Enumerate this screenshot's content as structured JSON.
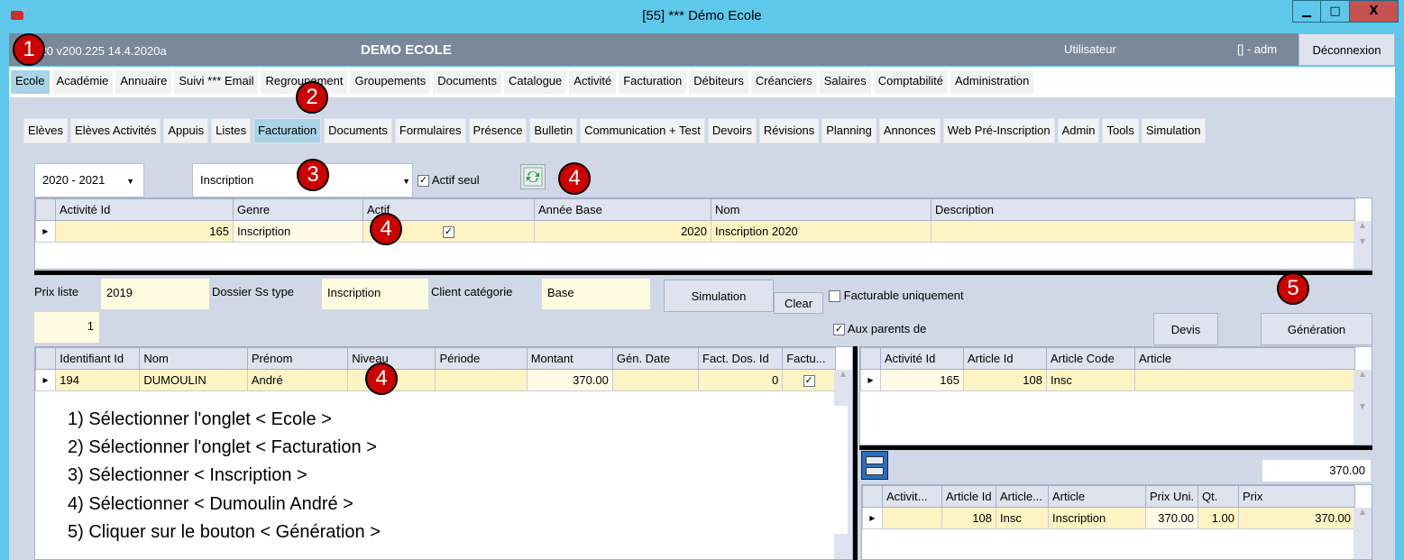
{
  "window": {
    "title": "[55] *** Démo Ecole",
    "controls": {
      "minimize": "▁",
      "maximize": "□",
      "close": "X"
    }
  },
  "header": {
    "version": "2020 v200.225 14.4.2020a",
    "org_name": "DEMO ECOLE",
    "user_label": "Utilisateur",
    "user_value": "[] - adm",
    "logout_label": "Déconnexion"
  },
  "main_menu": [
    {
      "label": "Ecole",
      "active": true
    },
    {
      "label": "Académie"
    },
    {
      "label": "Annuaire"
    },
    {
      "label": "Suivi *** Email"
    },
    {
      "label": "Regroupement"
    },
    {
      "label": "Groupements"
    },
    {
      "label": "Documents"
    },
    {
      "label": "Catalogue"
    },
    {
      "label": "Activité"
    },
    {
      "label": "Facturation"
    },
    {
      "label": "Débiteurs"
    },
    {
      "label": "Créanciers"
    },
    {
      "label": "Salaires"
    },
    {
      "label": "Comptabilité"
    },
    {
      "label": "Administration"
    }
  ],
  "sub_tabs": [
    {
      "label": "Elèves"
    },
    {
      "label": "Elèves Activités"
    },
    {
      "label": "Appuis"
    },
    {
      "label": "Listes"
    },
    {
      "label": "Facturation",
      "active": true
    },
    {
      "label": "Documents"
    },
    {
      "label": "Formulaires"
    },
    {
      "label": "Présence"
    },
    {
      "label": "Bulletin"
    },
    {
      "label": "Communication + Test"
    },
    {
      "label": "Devoirs"
    },
    {
      "label": "Révisions"
    },
    {
      "label": "Planning"
    },
    {
      "label": "Annonces"
    },
    {
      "label": "Web Pré-Inscription"
    },
    {
      "label": "Admin"
    },
    {
      "label": "Tools"
    },
    {
      "label": "Simulation"
    }
  ],
  "filters": {
    "year": "2020 - 2021",
    "genre": "Inscription",
    "active_only_label": "Actif seul",
    "active_only_checked": true,
    "refresh_icon": "refresh-icon"
  },
  "activity_grid": {
    "columns": [
      "Activité Id",
      "Genre",
      "Actif",
      "Année Base",
      "Nom",
      "Description"
    ],
    "rows": [
      {
        "activite_id": "165",
        "genre": "Inscription",
        "actif": true,
        "annee_base": "2020",
        "nom": "Inscription 2020",
        "description": ""
      }
    ]
  },
  "info_fields": {
    "prix_liste_label": "Prix liste",
    "prix_liste_value": "2019",
    "dossier_label": "Dossier Ss type",
    "dossier_value": "Inscription",
    "client_label": "Client catégorie",
    "client_value": "Base",
    "count_value": "1"
  },
  "actions": {
    "simulation": "Simulation",
    "clear": "Clear",
    "facturable_label": "Facturable uniquement",
    "facturable_checked": false,
    "parents_label": "Aux parents de",
    "parents_checked": true,
    "devis": "Devis",
    "generation": "Génération"
  },
  "student_grid": {
    "columns": [
      "Identifiant Id",
      "Nom",
      "Prénom",
      "Niveau",
      "Période",
      "Montant",
      "Gén. Date",
      "Fact. Dos. Id",
      "Factu..."
    ],
    "rows": [
      {
        "id": "194",
        "nom": "DUMOULIN",
        "prenom": "André",
        "niveau": "",
        "periode": "",
        "montant": "370.00",
        "gen_date": "",
        "fact_dos_id": "0",
        "factu": true
      }
    ]
  },
  "article_grid": {
    "columns": [
      "Activité Id",
      "Article Id",
      "Article Code",
      "Article"
    ],
    "rows": [
      {
        "activite_id": "165",
        "article_id": "108",
        "article_code": "Insc",
        "article": ""
      }
    ]
  },
  "detail": {
    "total": "370.00",
    "save_icon": "save-icon",
    "columns": [
      "Activit...",
      "Article Id",
      "Article...",
      "Article",
      "Prix Uni.",
      "Qt.",
      "Prix"
    ],
    "rows": [
      {
        "activite": "",
        "article_id": "108",
        "article_code": "Insc",
        "article": "Inscription",
        "prix_uni": "370.00",
        "qt": "1.00",
        "prix": "370.00"
      }
    ]
  },
  "badges": [
    "1",
    "2",
    "3",
    "4",
    "4",
    "4",
    "5"
  ],
  "instructions": [
    "1) Sélectionner l'onglet < Ecole >",
    "2) Sélectionner l'onglet < Facturation >",
    "3) Sélectionner < Inscription >",
    "4) Sélectionner < Dumoulin André >",
    "5) Cliquer sur le bouton < Génération >"
  ]
}
